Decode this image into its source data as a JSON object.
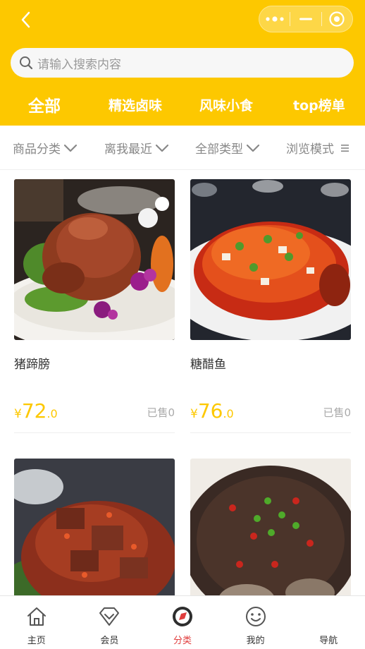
{
  "search": {
    "placeholder": "请输入搜索内容"
  },
  "top_tabs": [
    {
      "label": "全部",
      "active": true
    },
    {
      "label": "精选卤味",
      "active": false
    },
    {
      "label": "风味小食",
      "active": false
    },
    {
      "label": "top榜单",
      "active": false
    }
  ],
  "filters": [
    {
      "label": "商品分类",
      "icon": "chevron-down-icon"
    },
    {
      "label": "离我最近",
      "icon": "chevron-down-icon"
    },
    {
      "label": "全部类型",
      "icon": "chevron-down-icon"
    },
    {
      "label": "浏览模式",
      "icon": "list-icon"
    }
  ],
  "products": [
    {
      "name": "猪蹄膀",
      "currency": "¥",
      "price_int": "72",
      "price_dec": ".0",
      "sold": "已售0"
    },
    {
      "name": "糖醋鱼",
      "currency": "¥",
      "price_int": "76",
      "price_dec": ".0",
      "sold": "已售0"
    },
    {
      "name": "",
      "currency": "",
      "price_int": "",
      "price_dec": "",
      "sold": ""
    },
    {
      "name": "",
      "currency": "",
      "price_int": "",
      "price_dec": "",
      "sold": ""
    }
  ],
  "tabbar": [
    {
      "label": "主页",
      "icon": "home-icon",
      "active": false
    },
    {
      "label": "会员",
      "icon": "diamond-icon",
      "active": false
    },
    {
      "label": "分类",
      "icon": "category-icon",
      "active": true
    },
    {
      "label": "我的",
      "icon": "smile-icon",
      "active": false
    },
    {
      "label": "导航",
      "icon": "navigation-icon",
      "active": false
    }
  ],
  "colors": {
    "brand": "#fdc800",
    "price": "#fdc800",
    "active_tab": "#e03c3c"
  }
}
